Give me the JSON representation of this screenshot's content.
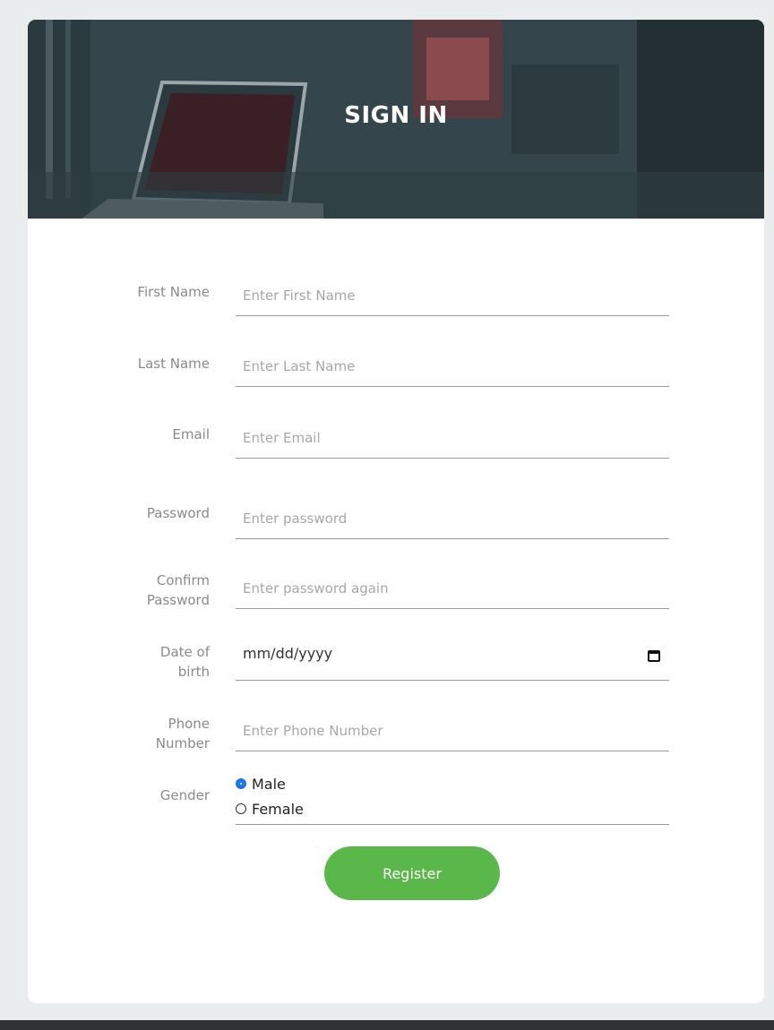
{
  "header": {
    "title": "SIGN IN"
  },
  "form": {
    "first_name": {
      "label": "First Name",
      "placeholder": "Enter First Name"
    },
    "last_name": {
      "label": "Last Name",
      "placeholder": "Enter Last Name"
    },
    "email": {
      "label": "Email",
      "placeholder": "Enter Email"
    },
    "password": {
      "label": "Password",
      "placeholder": "Enter password"
    },
    "confirm_password": {
      "label_line1": "Confirm",
      "label_line2": "Password",
      "placeholder": "Enter password again"
    },
    "dob": {
      "label_line1": "Date of",
      "label_line2": "birth",
      "value": "mm/dd/yyyy"
    },
    "phone": {
      "label_line1": "Phone",
      "label_line2": "Number",
      "placeholder": "Enter Phone Number"
    },
    "gender": {
      "label": "Gender",
      "options": [
        {
          "label": "Male",
          "checked": true
        },
        {
          "label": "Female",
          "checked": false
        }
      ]
    },
    "register_label": "Register"
  },
  "colors": {
    "accent_button": "#5ab84a",
    "hero_overlay": "#34464b",
    "radio_selected": "#1a73e8"
  },
  "icons": {
    "date_picker": "calendar-icon"
  }
}
